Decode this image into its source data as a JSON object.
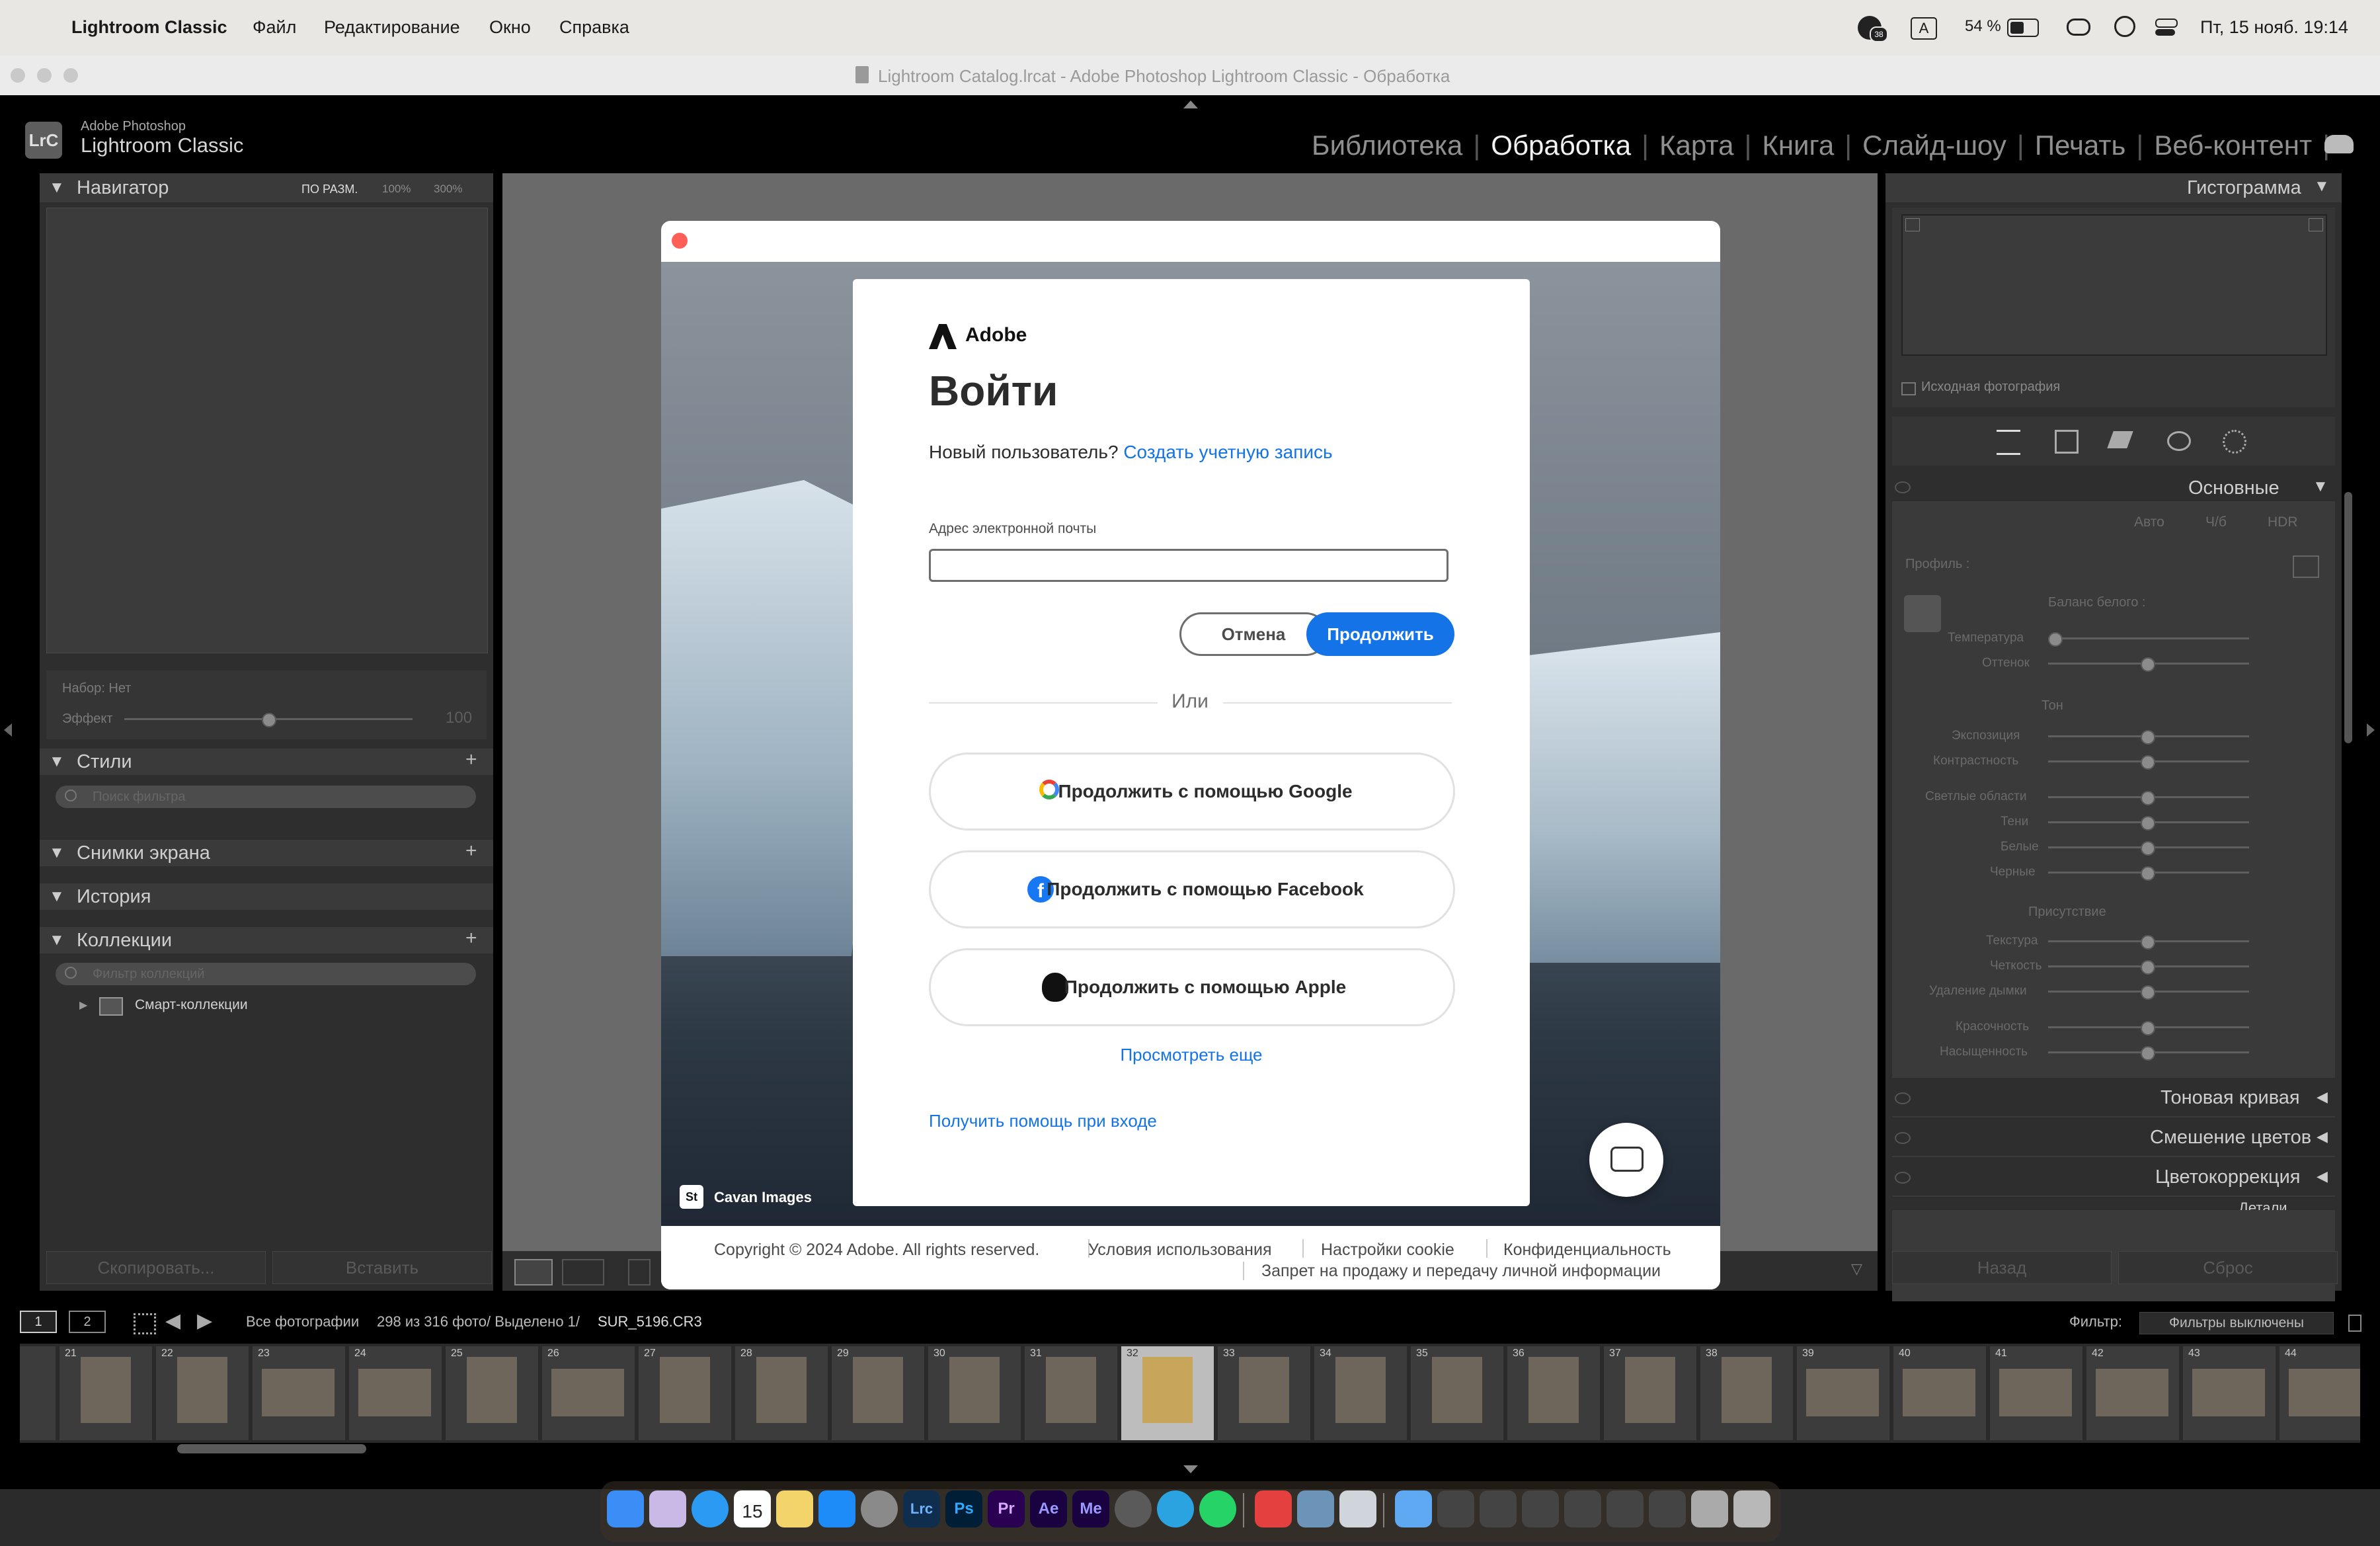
{
  "menubar": {
    "app": "Lightroom Classic",
    "items": [
      "Файл",
      "Редактирование",
      "Окно",
      "Справка"
    ],
    "status": {
      "notifications": "38",
      "input": "A",
      "battery": "54 %",
      "datetime": "Пт, 15 нояб.  19:14"
    }
  },
  "window": {
    "title": "Lightroom Catalog.lrcat - Adobe Photoshop Lightroom Classic - Обработка"
  },
  "lr": {
    "brand_small": "Adobe Photoshop",
    "brand_big": "Lightroom Classic",
    "logo": "LrC",
    "modules": [
      "Библиотека",
      "Обработка",
      "Карта",
      "Книга",
      "Слайд-шоу",
      "Печать",
      "Веб-контент"
    ],
    "active_module": "Обработка"
  },
  "left": {
    "navigator": {
      "title": "Навигатор",
      "fit": "ПО РАЗМ.",
      "z1": "100%",
      "z2": "300%"
    },
    "preset": {
      "set": "Набор: Нет",
      "effect": "Эффект",
      "value": "100"
    },
    "styles": {
      "title": "Стили",
      "search": "Поиск фильтра"
    },
    "snapshots": "Снимки экрана",
    "history": "История",
    "collections": {
      "title": "Коллекции",
      "filter": "Фильтр коллекций",
      "smart": "Смарт-коллекции"
    },
    "copy": "Скопировать...",
    "paste": "Вставить"
  },
  "right": {
    "histogram": "Гистограмма",
    "original": "Исходная фотография",
    "basic": "Основные",
    "modes": [
      "Авто",
      "Ч/б",
      "HDR"
    ],
    "profile": "Профиль :",
    "wb": "Баланс белого :",
    "wb_sliders": [
      "Температура",
      "Оттенок"
    ],
    "tone_title": "Тон",
    "tone_a": [
      "Экспозиция",
      "Контрастность"
    ],
    "tone_b": [
      "Светлые области",
      "Тени",
      "Белые",
      "Черные"
    ],
    "presence_title": "Присутствие",
    "presence_a": [
      "Текстура",
      "Четкость",
      "Удаление дымки"
    ],
    "presence_b": [
      "Красочность",
      "Насыщенность"
    ],
    "sections": [
      "Тоновая кривая",
      "Смешение цветов",
      "Цветокоррекция",
      "Детали"
    ],
    "prev": "Назад",
    "reset": "Сброс"
  },
  "filmstrip": {
    "view1": "1",
    "view2": "2",
    "source": "Все фотографии",
    "count": "298 из 316 фото/ Выделено 1/",
    "file": "SUR_5196.CR3",
    "filter_label": "Фильтр:",
    "filter_value": "Фильтры выключены",
    "numbers": [
      "21",
      "22",
      "23",
      "24",
      "25",
      "26",
      "27",
      "28",
      "29",
      "30",
      "31",
      "32",
      "33",
      "34",
      "35",
      "36",
      "37",
      "38",
      "39",
      "40",
      "41",
      "42",
      "43",
      "44"
    ]
  },
  "dialog": {
    "brand": "Adobe",
    "heading": "Войти",
    "new_user": "Новый пользователь?",
    "create_account": "Создать учетную запись",
    "email_label": "Адрес электронной почты",
    "email_value": "",
    "cancel": "Отмена",
    "continue": "Продолжить",
    "or": "Или",
    "google": "Продолжить с помощью Google",
    "facebook": "Продолжить с помощью Facebook",
    "apple": "Продолжить с помощью Apple",
    "more": "Просмотреть еще",
    "help": "Получить помощь при входе",
    "credit_tag": "St",
    "credit": "Cavan Images",
    "copyright": "Copyright © 2024 Adobe. All rights reserved.",
    "terms": "Условия использования",
    "cookies": "Настройки cookie",
    "privacy": "Конфиденциальность",
    "nosell": "Запрет на продажу и передачу личной информации"
  },
  "dock": {
    "calendar_day": "15",
    "apps": [
      "Lrc",
      "Ps",
      "Pr",
      "Ae",
      "Me"
    ]
  },
  "colors": {
    "accent": "#1473e6",
    "lr_bg": "#000000",
    "panel": "#393939"
  }
}
